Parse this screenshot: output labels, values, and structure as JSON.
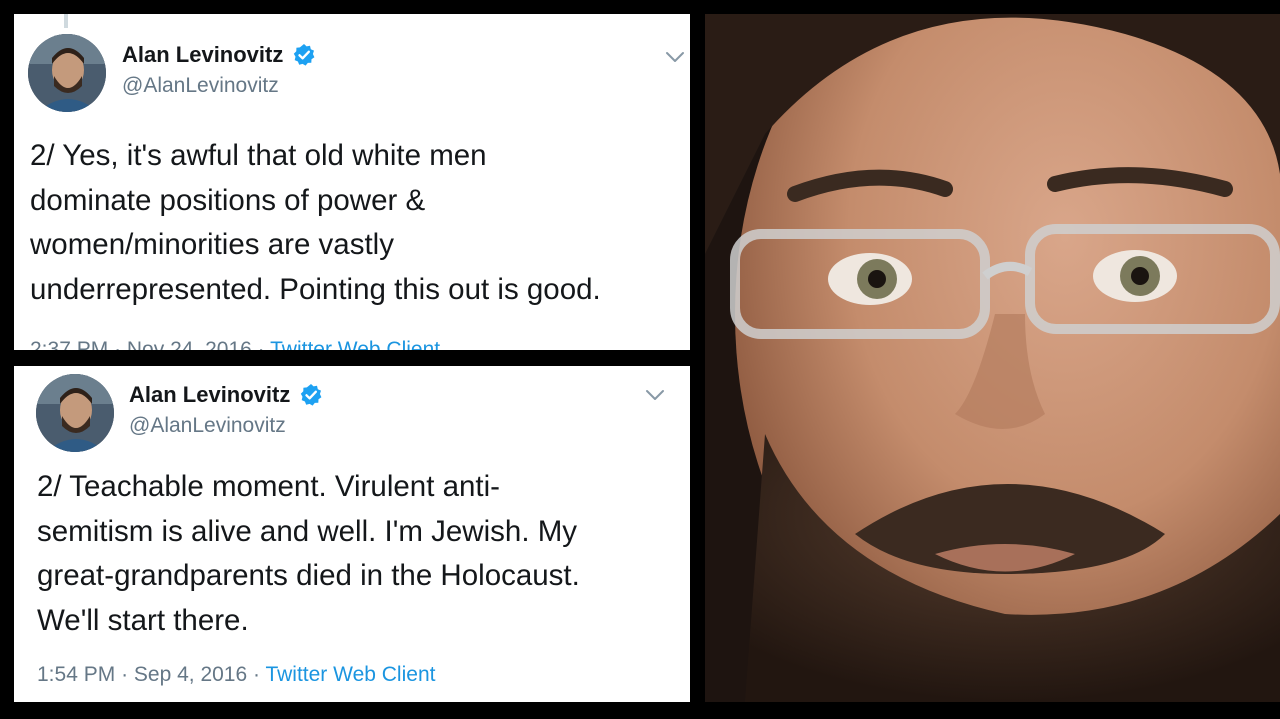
{
  "tweets": [
    {
      "author_name": "Alan Levinovitz",
      "handle": "@AlanLevinovitz",
      "text": "2/ Yes, it's awful that old white men\ndominate positions of power &\nwomen/minorities are vastly\nunderrepresented. Pointing this out is good.",
      "time": "2:37 PM",
      "date": "Nov 24, 2016",
      "source": "Twitter Web Client",
      "verified_icon": "verified-badge-icon",
      "menu_icon": "chevron-down-icon"
    },
    {
      "author_name": "Alan Levinovitz",
      "handle": "@AlanLevinovitz",
      "text": "2/ Teachable moment. Virulent anti-\nsemitism is alive and well. I'm Jewish. My\ngreat-grandparents died in the Holocaust.\nWe'll start there.",
      "time": "1:54 PM",
      "date": "Sep 4, 2016",
      "source": "Twitter Web Client",
      "verified_icon": "verified-badge-icon",
      "menu_icon": "chevron-down-icon"
    }
  ],
  "colors": {
    "background": "#000000",
    "card": "#ffffff",
    "name": "#14171a",
    "secondary": "#657786",
    "link": "#1b95e0",
    "verified": "#1da1f2"
  }
}
